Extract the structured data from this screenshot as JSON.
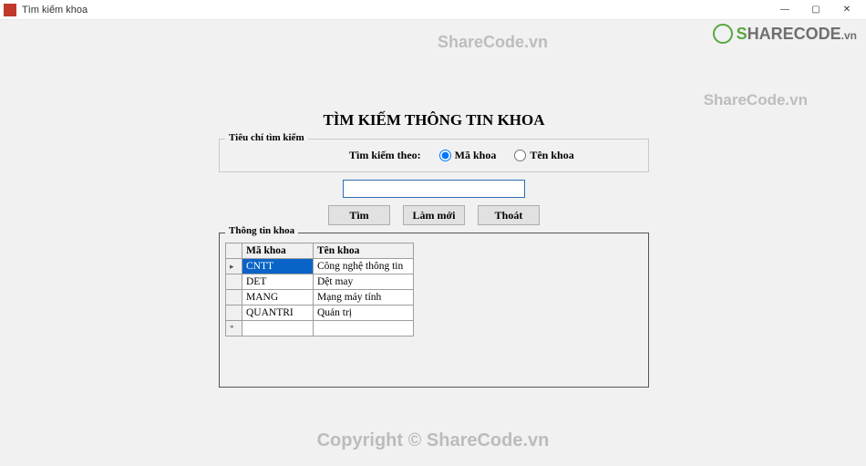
{
  "window": {
    "title": "Tìm kiếm khoa",
    "min": "—",
    "max": "▢",
    "close": "✕"
  },
  "watermarks": {
    "top": "ShareCode.vn",
    "right": "ShareCode.vn",
    "footer": "Copyright © ShareCode.vn",
    "logo_s": "S",
    "logo_rest": "HARECODE",
    "logo_vn": ".vn"
  },
  "form": {
    "heading": "TÌM KIẾM THÔNG TIN KHOA",
    "criteria_legend": "Tiêu chí tìm kiếm",
    "search_by_label": "Tìm kiếm theo:",
    "radio_ma": "Mã khoa",
    "radio_ten": "Tên khoa",
    "search_value": "",
    "btn_search": "Tìm",
    "btn_refresh": "Làm mới",
    "btn_exit": "Thoát",
    "grid_legend": "Thông tin khoa",
    "columns": {
      "ma": "Mã khoa",
      "ten": "Tên khoa"
    },
    "rows": [
      {
        "ma": "CNTT",
        "ten": "Công nghệ thông tin"
      },
      {
        "ma": "DET",
        "ten": "Dệt may"
      },
      {
        "ma": "MANG",
        "ten": "Mạng máy tính"
      },
      {
        "ma": "QUANTRI",
        "ten": "Quản trị"
      }
    ]
  }
}
